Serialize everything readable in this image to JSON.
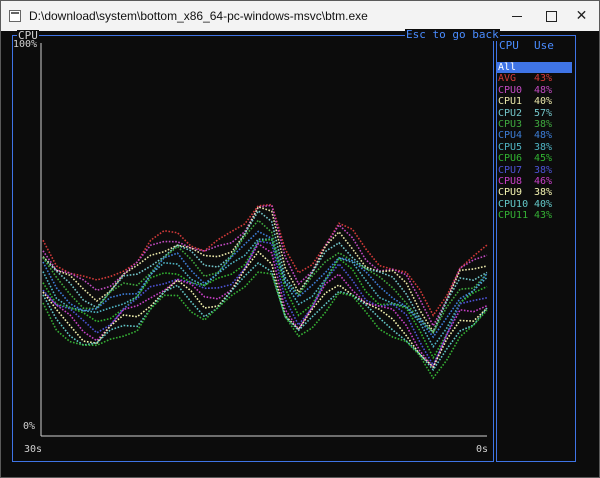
{
  "window": {
    "title": "D:\\download\\system\\bottom_x86_64-pc-windows-msvc\\btm.exe",
    "close_glyph": "✕"
  },
  "graph": {
    "title": "CPU",
    "esc_hint": "Esc to go back",
    "y_max_label": "100%",
    "y_min_label": "0%",
    "x_left_label": "30s",
    "x_right_label": "0s"
  },
  "list": {
    "header_cpu": "CPU",
    "header_use": "Use",
    "selected_color": "#3f74e6",
    "rows": [
      {
        "name": "All",
        "use": "",
        "color": "#ffffff",
        "selected": true
      },
      {
        "name": "AVG",
        "use": "43%",
        "color": "#d33a3a"
      },
      {
        "name": "CPU0",
        "use": "48%",
        "color": "#c24bc2"
      },
      {
        "name": "CPU1",
        "use": "40%",
        "color": "#e9e6a8"
      },
      {
        "name": "CPU2",
        "use": "57%",
        "color": "#73c5c9"
      },
      {
        "name": "CPU3",
        "use": "38%",
        "color": "#3fa93f"
      },
      {
        "name": "CPU4",
        "use": "48%",
        "color": "#3d7ed8"
      },
      {
        "name": "CPU5",
        "use": "38%",
        "color": "#4fb4c4"
      },
      {
        "name": "CPU6",
        "use": "45%",
        "color": "#31b431"
      },
      {
        "name": "CPU7",
        "use": "38%",
        "color": "#4d54d6"
      },
      {
        "name": "CPU8",
        "use": "46%",
        "color": "#c840c8"
      },
      {
        "name": "CPU9",
        "use": "38%",
        "color": "#f3f3b0"
      },
      {
        "name": "CPU10",
        "use": "40%",
        "color": "#63c8c8"
      },
      {
        "name": "CPU11",
        "use": "43%",
        "color": "#35b035"
      }
    ]
  }
}
